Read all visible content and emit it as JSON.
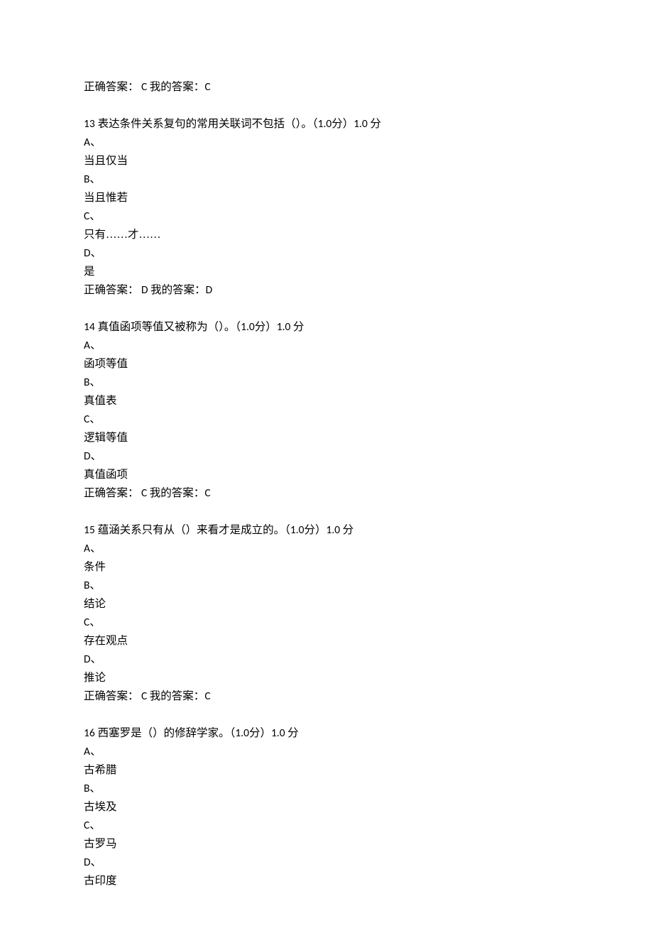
{
  "q12": {
    "answer_line_prefix": "正确答案：",
    "correct": " C ",
    "my_prefix": "我的答案：",
    "my": "C"
  },
  "q13": {
    "num": "13",
    "stem": " 表达条件关系复句的常用关联词不包括（）。（",
    "pts1": "1.0",
    "pts1_unit": "分）",
    "pts2": "1.0 ",
    "pts2_unit": "分",
    "A": "A、",
    "A_text": "当且仅当",
    "B": "B、",
    "B_text": "当且惟若",
    "C": "C、",
    "C_text": "只有……才……",
    "D": "D、",
    "D_text": "是",
    "answer_line_prefix": "正确答案：",
    "correct": " D ",
    "my_prefix": "我的答案：",
    "my": "D"
  },
  "q14": {
    "num": "14",
    "stem": " 真值函项等值又被称为（）。（",
    "pts1": "1.0",
    "pts1_unit": "分）",
    "pts2": "1.0 ",
    "pts2_unit": "分",
    "A": "A、",
    "A_text": "函项等值",
    "B": "B、",
    "B_text": "真值表",
    "C": "C、",
    "C_text": "逻辑等值",
    "D": "D、",
    "D_text": "真值函项",
    "answer_line_prefix": "正确答案：",
    "correct": " C ",
    "my_prefix": "我的答案：",
    "my": "C"
  },
  "q15": {
    "num": "15",
    "stem": " 蕴涵关系只有从（）来看才是成立的。（",
    "pts1": "1.0",
    "pts1_unit": "分）",
    "pts2": "1.0 ",
    "pts2_unit": "分",
    "A": "A、",
    "A_text": "条件",
    "B": "B、",
    "B_text": "结论",
    "C": "C、",
    "C_text": "存在观点",
    "D": "D、",
    "D_text": "推论",
    "answer_line_prefix": "正确答案：",
    "correct": " C ",
    "my_prefix": "我的答案：",
    "my": "C"
  },
  "q16": {
    "num": "16",
    "stem": " 西塞罗是（）的修辞学家。（",
    "pts1": "1.0",
    "pts1_unit": "分）",
    "pts2": "1.0 ",
    "pts2_unit": "分",
    "A": "A、",
    "A_text": "古希腊",
    "B": "B、",
    "B_text": "古埃及",
    "C": "C、",
    "C_text": "古罗马",
    "D": "D、",
    "D_text": "古印度"
  }
}
